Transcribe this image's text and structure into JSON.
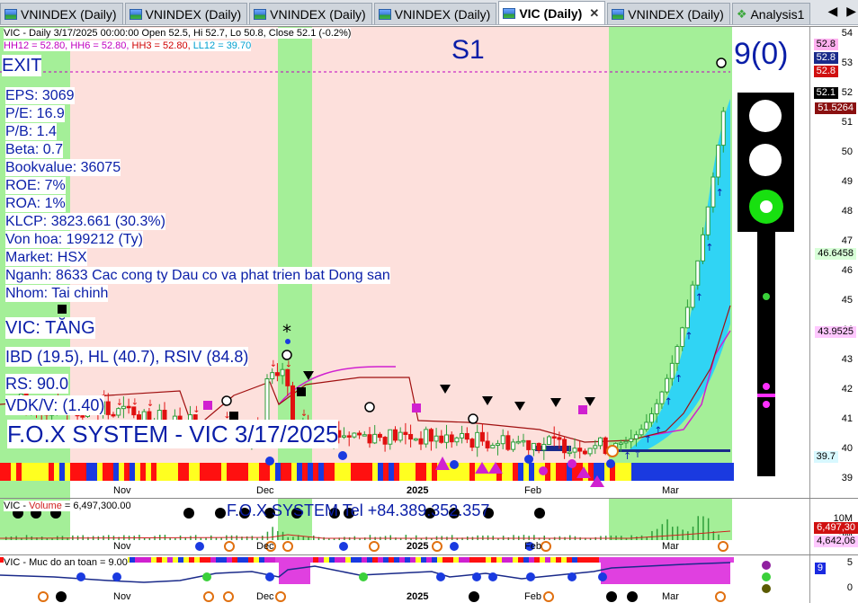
{
  "tabs": [
    {
      "label": "VNINDEX (Daily)",
      "active": false
    },
    {
      "label": "VNINDEX (Daily)",
      "active": false
    },
    {
      "label": "VNINDEX (Daily)",
      "active": false
    },
    {
      "label": "VNINDEX (Daily)",
      "active": false
    },
    {
      "label": "VIC (Daily)",
      "active": true
    },
    {
      "label": "VNINDEX (Daily)",
      "active": false
    },
    {
      "label": "Analysis1",
      "active": false
    }
  ],
  "tab_close_glyph": "✕",
  "nav_prev": "◀",
  "nav_next": "▶",
  "main": {
    "header": "VIC - Daily 3/17/2025 00:00:00 Open 52.5, Hi 52.7, Lo 50.8, Close 52.1 (-0.2%)",
    "hh12": "HH12 = 52.80,",
    "hh6": "HH6 = 52.80,",
    "hh3": "HH3 = 52.80,",
    "ll12": "LL12 = 39.70",
    "signal": "S1",
    "exit": "EXIT",
    "count": "9(0)",
    "fundamentals": [
      "EPS: 3069",
      "P/E: 16.9",
      "P/B: 1.4",
      "Beta: 0.7",
      "Bookvalue: 36075",
      "ROE: 7%",
      "ROA: 1%",
      "KLCP: 3823.661 (30.3%)",
      "Von hoa: 199212 (Ty)",
      "Market: HSX",
      "Nganh: 8633 Cac cong ty Dau co va phat trien bat Dong san",
      "Nhom: Tai chinh"
    ],
    "trend": "VIC: TĂNG",
    "ibd": "IBD (19.5), HL (40.7), RSIV (84.8)",
    "rs": "RS: 90.0",
    "vdk": "VDK/V:  (1.40)",
    "watermark": "F.O.X SYSTEM - VIC 3/17/2025",
    "yticks": [
      "54",
      "53",
      "52",
      "51",
      "50",
      "49",
      "48",
      "47",
      "46",
      "45",
      "44",
      "43",
      "42",
      "41",
      "40",
      "39"
    ],
    "tags": {
      "top1": "52.8",
      "top2": "52.8",
      "top3": "52.8",
      "last": "52.1",
      "ma": "51.5264",
      "green": "46.6458",
      "magenta": "43.9525",
      "cyan": "39.7"
    },
    "xlabels": [
      "Nov",
      "Dec",
      "2025",
      "Feb",
      "Mar"
    ]
  },
  "volume": {
    "header_prefix": "VIC - ",
    "header_label": "Volume",
    "header_value": " = 6,497,300.00",
    "title": "F.O.X SYSTEM Tel +84.389.352.357",
    "yticks": [
      "10M",
      "5M"
    ],
    "tags": {
      "v1": "6,497,30",
      "v2": "4,642,06"
    },
    "xlabels": [
      "Nov",
      "Dec",
      "2025",
      "Feb",
      "Mar"
    ]
  },
  "safety": {
    "header": "VIC - Muc do an toan = 9.00",
    "yticks": [
      "5",
      "0"
    ],
    "tag": "9",
    "xlabels": [
      "Nov",
      "Dec",
      "2025",
      "Feb",
      "Mar"
    ]
  },
  "colors": {
    "up": "#2e9e3a",
    "down": "#e01010",
    "blue": "#0a1ea8",
    "magenta": "#d020d0",
    "cyan": "#20c8f0",
    "greenzone": "#a4ef98",
    "pinkzone": "#fde0dc"
  }
}
